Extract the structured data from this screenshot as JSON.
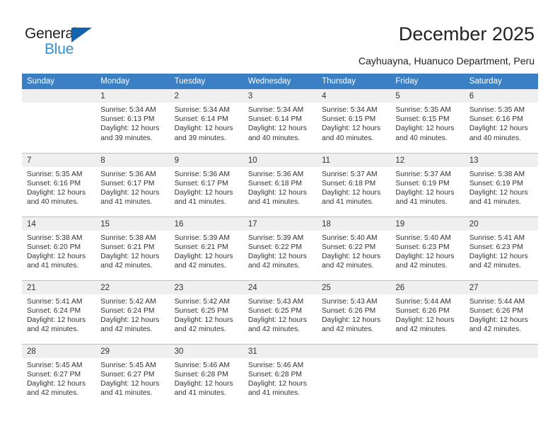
{
  "logo": {
    "word_dark": "General",
    "word_blue": "Blue",
    "triangle_color": "#1263ad",
    "blue_color": "#2e8fd6"
  },
  "header": {
    "title": "December 2025",
    "subtitle": "Cayhuayna, Huanuco Department, Peru"
  },
  "theme": {
    "header_row_bg": "#3b7fc4",
    "daynum_band_bg": "#efeff0",
    "grid_line": "#bfbfbf",
    "text": "#333333"
  },
  "weekday_headers": [
    "Sunday",
    "Monday",
    "Tuesday",
    "Wednesday",
    "Thursday",
    "Friday",
    "Saturday"
  ],
  "weeks": [
    [
      {
        "day": "",
        "sunrise": "",
        "sunset": "",
        "daylight1": "",
        "daylight2": ""
      },
      {
        "day": "1",
        "sunrise": "Sunrise: 5:34 AM",
        "sunset": "Sunset: 6:13 PM",
        "daylight1": "Daylight: 12 hours",
        "daylight2": "and 39 minutes."
      },
      {
        "day": "2",
        "sunrise": "Sunrise: 5:34 AM",
        "sunset": "Sunset: 6:14 PM",
        "daylight1": "Daylight: 12 hours",
        "daylight2": "and 39 minutes."
      },
      {
        "day": "3",
        "sunrise": "Sunrise: 5:34 AM",
        "sunset": "Sunset: 6:14 PM",
        "daylight1": "Daylight: 12 hours",
        "daylight2": "and 40 minutes."
      },
      {
        "day": "4",
        "sunrise": "Sunrise: 5:34 AM",
        "sunset": "Sunset: 6:15 PM",
        "daylight1": "Daylight: 12 hours",
        "daylight2": "and 40 minutes."
      },
      {
        "day": "5",
        "sunrise": "Sunrise: 5:35 AM",
        "sunset": "Sunset: 6:15 PM",
        "daylight1": "Daylight: 12 hours",
        "daylight2": "and 40 minutes."
      },
      {
        "day": "6",
        "sunrise": "Sunrise: 5:35 AM",
        "sunset": "Sunset: 6:16 PM",
        "daylight1": "Daylight: 12 hours",
        "daylight2": "and 40 minutes."
      }
    ],
    [
      {
        "day": "7",
        "sunrise": "Sunrise: 5:35 AM",
        "sunset": "Sunset: 6:16 PM",
        "daylight1": "Daylight: 12 hours",
        "daylight2": "and 40 minutes."
      },
      {
        "day": "8",
        "sunrise": "Sunrise: 5:36 AM",
        "sunset": "Sunset: 6:17 PM",
        "daylight1": "Daylight: 12 hours",
        "daylight2": "and 41 minutes."
      },
      {
        "day": "9",
        "sunrise": "Sunrise: 5:36 AM",
        "sunset": "Sunset: 6:17 PM",
        "daylight1": "Daylight: 12 hours",
        "daylight2": "and 41 minutes."
      },
      {
        "day": "10",
        "sunrise": "Sunrise: 5:36 AM",
        "sunset": "Sunset: 6:18 PM",
        "daylight1": "Daylight: 12 hours",
        "daylight2": "and 41 minutes."
      },
      {
        "day": "11",
        "sunrise": "Sunrise: 5:37 AM",
        "sunset": "Sunset: 6:18 PM",
        "daylight1": "Daylight: 12 hours",
        "daylight2": "and 41 minutes."
      },
      {
        "day": "12",
        "sunrise": "Sunrise: 5:37 AM",
        "sunset": "Sunset: 6:19 PM",
        "daylight1": "Daylight: 12 hours",
        "daylight2": "and 41 minutes."
      },
      {
        "day": "13",
        "sunrise": "Sunrise: 5:38 AM",
        "sunset": "Sunset: 6:19 PM",
        "daylight1": "Daylight: 12 hours",
        "daylight2": "and 41 minutes."
      }
    ],
    [
      {
        "day": "14",
        "sunrise": "Sunrise: 5:38 AM",
        "sunset": "Sunset: 6:20 PM",
        "daylight1": "Daylight: 12 hours",
        "daylight2": "and 41 minutes."
      },
      {
        "day": "15",
        "sunrise": "Sunrise: 5:38 AM",
        "sunset": "Sunset: 6:21 PM",
        "daylight1": "Daylight: 12 hours",
        "daylight2": "and 42 minutes."
      },
      {
        "day": "16",
        "sunrise": "Sunrise: 5:39 AM",
        "sunset": "Sunset: 6:21 PM",
        "daylight1": "Daylight: 12 hours",
        "daylight2": "and 42 minutes."
      },
      {
        "day": "17",
        "sunrise": "Sunrise: 5:39 AM",
        "sunset": "Sunset: 6:22 PM",
        "daylight1": "Daylight: 12 hours",
        "daylight2": "and 42 minutes."
      },
      {
        "day": "18",
        "sunrise": "Sunrise: 5:40 AM",
        "sunset": "Sunset: 6:22 PM",
        "daylight1": "Daylight: 12 hours",
        "daylight2": "and 42 minutes."
      },
      {
        "day": "19",
        "sunrise": "Sunrise: 5:40 AM",
        "sunset": "Sunset: 6:23 PM",
        "daylight1": "Daylight: 12 hours",
        "daylight2": "and 42 minutes."
      },
      {
        "day": "20",
        "sunrise": "Sunrise: 5:41 AM",
        "sunset": "Sunset: 6:23 PM",
        "daylight1": "Daylight: 12 hours",
        "daylight2": "and 42 minutes."
      }
    ],
    [
      {
        "day": "21",
        "sunrise": "Sunrise: 5:41 AM",
        "sunset": "Sunset: 6:24 PM",
        "daylight1": "Daylight: 12 hours",
        "daylight2": "and 42 minutes."
      },
      {
        "day": "22",
        "sunrise": "Sunrise: 5:42 AM",
        "sunset": "Sunset: 6:24 PM",
        "daylight1": "Daylight: 12 hours",
        "daylight2": "and 42 minutes."
      },
      {
        "day": "23",
        "sunrise": "Sunrise: 5:42 AM",
        "sunset": "Sunset: 6:25 PM",
        "daylight1": "Daylight: 12 hours",
        "daylight2": "and 42 minutes."
      },
      {
        "day": "24",
        "sunrise": "Sunrise: 5:43 AM",
        "sunset": "Sunset: 6:25 PM",
        "daylight1": "Daylight: 12 hours",
        "daylight2": "and 42 minutes."
      },
      {
        "day": "25",
        "sunrise": "Sunrise: 5:43 AM",
        "sunset": "Sunset: 6:26 PM",
        "daylight1": "Daylight: 12 hours",
        "daylight2": "and 42 minutes."
      },
      {
        "day": "26",
        "sunrise": "Sunrise: 5:44 AM",
        "sunset": "Sunset: 6:26 PM",
        "daylight1": "Daylight: 12 hours",
        "daylight2": "and 42 minutes."
      },
      {
        "day": "27",
        "sunrise": "Sunrise: 5:44 AM",
        "sunset": "Sunset: 6:26 PM",
        "daylight1": "Daylight: 12 hours",
        "daylight2": "and 42 minutes."
      }
    ],
    [
      {
        "day": "28",
        "sunrise": "Sunrise: 5:45 AM",
        "sunset": "Sunset: 6:27 PM",
        "daylight1": "Daylight: 12 hours",
        "daylight2": "and 42 minutes."
      },
      {
        "day": "29",
        "sunrise": "Sunrise: 5:45 AM",
        "sunset": "Sunset: 6:27 PM",
        "daylight1": "Daylight: 12 hours",
        "daylight2": "and 41 minutes."
      },
      {
        "day": "30",
        "sunrise": "Sunrise: 5:46 AM",
        "sunset": "Sunset: 6:28 PM",
        "daylight1": "Daylight: 12 hours",
        "daylight2": "and 41 minutes."
      },
      {
        "day": "31",
        "sunrise": "Sunrise: 5:46 AM",
        "sunset": "Sunset: 6:28 PM",
        "daylight1": "Daylight: 12 hours",
        "daylight2": "and 41 minutes."
      },
      {
        "day": "",
        "sunrise": "",
        "sunset": "",
        "daylight1": "",
        "daylight2": ""
      },
      {
        "day": "",
        "sunrise": "",
        "sunset": "",
        "daylight1": "",
        "daylight2": ""
      },
      {
        "day": "",
        "sunrise": "",
        "sunset": "",
        "daylight1": "",
        "daylight2": ""
      }
    ]
  ]
}
